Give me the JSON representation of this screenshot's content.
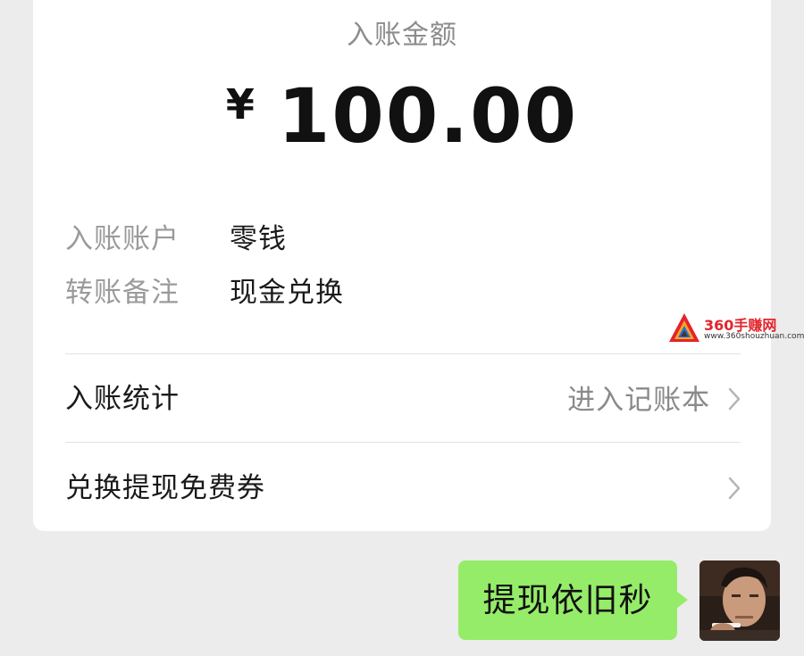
{
  "transfer": {
    "amount_label": "入账金额",
    "currency_symbol": "¥",
    "amount": "100.00",
    "details": [
      {
        "label": "入账账户",
        "value": "零钱"
      },
      {
        "label": "转账备注",
        "value": "现金兑换"
      }
    ],
    "links": [
      {
        "title": "入账统计",
        "action": "进入记账本"
      },
      {
        "title": "兑换提现免费券",
        "action": ""
      }
    ]
  },
  "watermark": {
    "brand": "360手赚网",
    "url": "www.360shouzhuan.com"
  },
  "chat": {
    "message": "提现依旧秒",
    "bubble_color": "#95ec69"
  },
  "icons": {
    "chevron": "chevron-right-icon",
    "avatar": "user-avatar"
  }
}
